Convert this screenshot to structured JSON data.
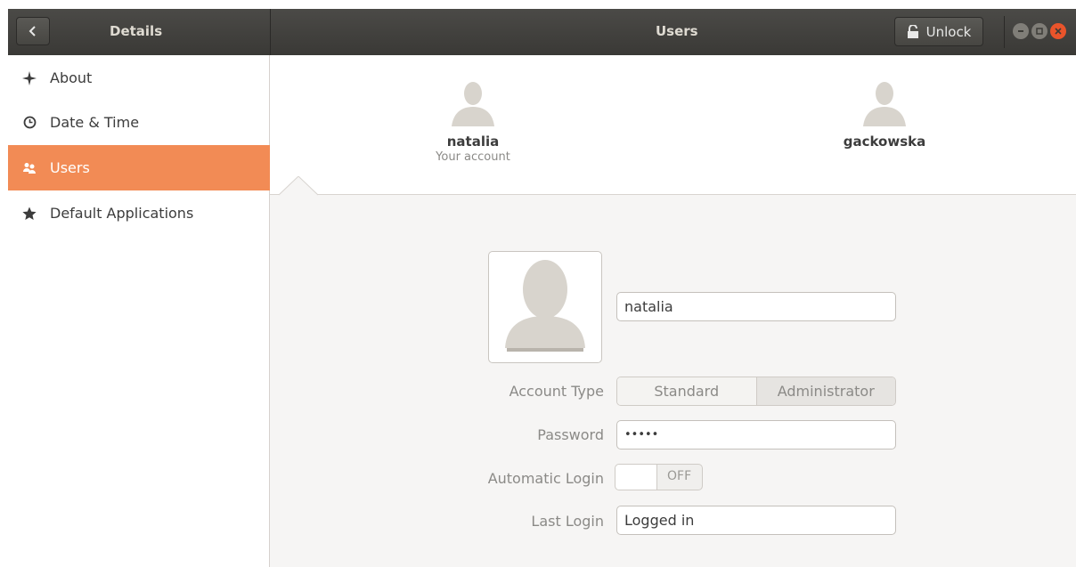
{
  "header": {
    "left_title": "Details",
    "title": "Users",
    "unlock_label": "Unlock"
  },
  "sidebar": {
    "items": [
      {
        "label": "About",
        "icon": "sparkle-icon",
        "active": false
      },
      {
        "label": "Date & Time",
        "icon": "clock-icon",
        "active": false
      },
      {
        "label": "Users",
        "icon": "users-icon",
        "active": true
      },
      {
        "label": "Default Applications",
        "icon": "star-icon",
        "active": false
      }
    ]
  },
  "users": [
    {
      "name": "natalia",
      "subtitle": "Your account"
    },
    {
      "name": "gackowska",
      "subtitle": ""
    }
  ],
  "details": {
    "name_value": "natalia",
    "account_type_label": "Account Type",
    "account_type_options": [
      "Standard",
      "Administrator"
    ],
    "account_type_selected": "Administrator",
    "password_label": "Password",
    "password_value": "•••••",
    "auto_login_label": "Automatic Login",
    "auto_login_state": "OFF",
    "last_login_label": "Last Login",
    "last_login_value": "Logged in"
  },
  "colors": {
    "accent": "#f28b55",
    "header": "#3c3b37",
    "close": "#e9542b"
  }
}
